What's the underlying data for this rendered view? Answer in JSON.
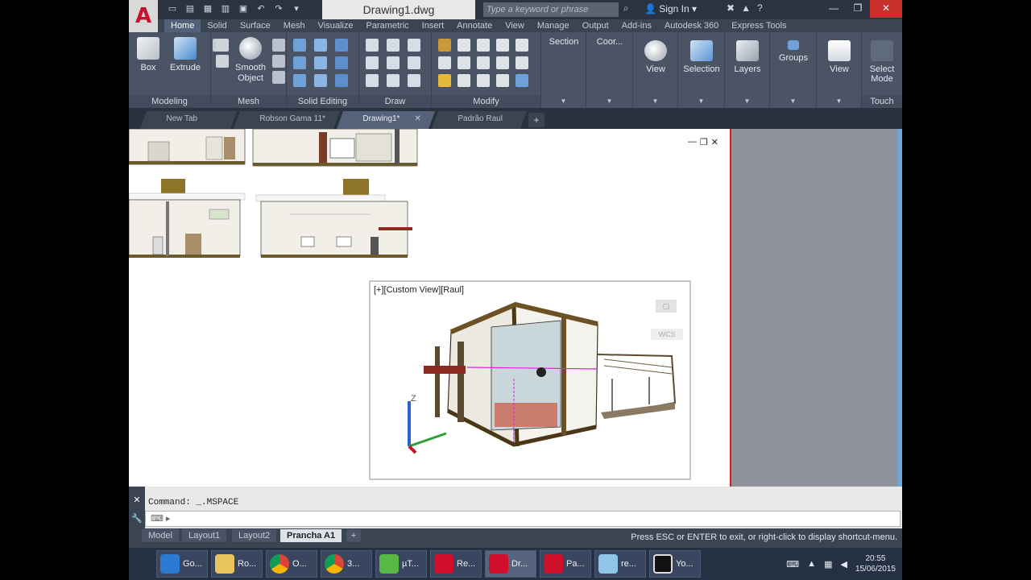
{
  "window": {
    "document_title": "Drawing1.dwg",
    "search_placeholder": "Type a keyword or phrase",
    "sign_in": "Sign In"
  },
  "ribbon_tabs": [
    "Home",
    "Solid",
    "Surface",
    "Mesh",
    "Visualize",
    "Parametric",
    "Insert",
    "Annotate",
    "View",
    "Manage",
    "Output",
    "Add-ins",
    "Autodesk 360",
    "Express Tools"
  ],
  "ribbon": {
    "box_label": "Box",
    "extrude_label": "Extrude",
    "smooth_object_label": "Smooth Object",
    "section_label": "Section",
    "coordinates_label": "Coor...",
    "view_label": "View",
    "selection_label": "Selection",
    "layers_label": "Layers",
    "groups_label": "Groups",
    "view2_label": "View",
    "select_mode_label": "Select Mode",
    "panels": {
      "modeling": "Modeling",
      "mesh": "Mesh",
      "solid_editing": "Solid Editing",
      "draw": "Draw",
      "modify": "Modify",
      "touch": "Touch"
    }
  },
  "file_tabs": [
    {
      "label": "New Tab"
    },
    {
      "label": "Robson Gama 11*"
    },
    {
      "label": "Drawing1*"
    },
    {
      "label": "Padrão Raul"
    }
  ],
  "viewport": {
    "label": "[+][Custom View][Raul]",
    "wcs": "WCS"
  },
  "command": {
    "history": "Command:  _.MSPACE",
    "prompt": ""
  },
  "layout_tabs": [
    "Model",
    "Layout1",
    "Layout2",
    "Prancha A1"
  ],
  "status_message": "Press ESC or ENTER to exit, or right-click to display shortcut-menu.",
  "taskbar": {
    "items": [
      "Go...",
      "Ro...",
      "O...",
      "3...",
      "µT...",
      "Re...",
      "Dr...",
      "Pa...",
      "re...",
      "Yo..."
    ],
    "time": "20:55",
    "date": "15/06/2015"
  },
  "colors": {
    "autocad_red": "#c8102e",
    "ribbon_bg": "#4a5465",
    "canvas_bg": "#ffffff",
    "viewport_border": "#c22222"
  }
}
